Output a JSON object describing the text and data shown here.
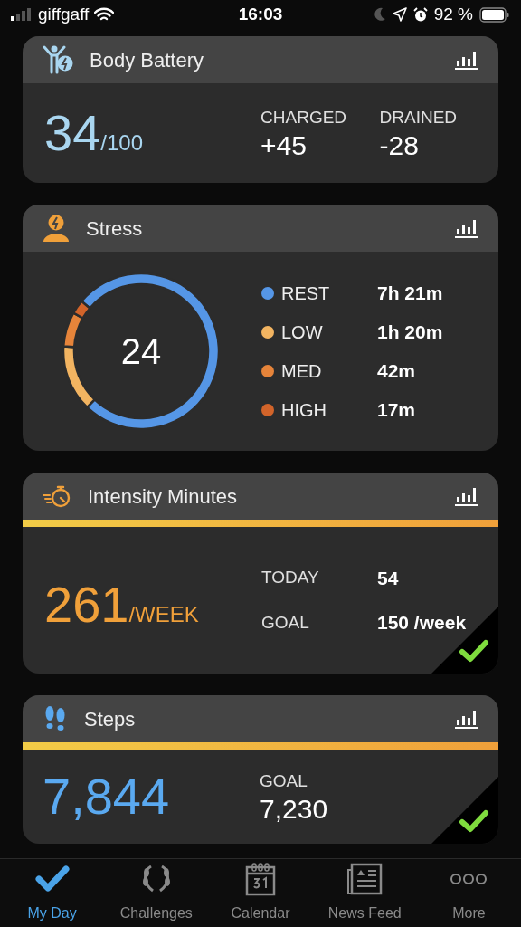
{
  "status_bar": {
    "carrier": "giffgaff",
    "time": "16:03",
    "battery": "92 %"
  },
  "body_battery": {
    "title": "Body Battery",
    "value": "34",
    "max": "/100",
    "stats": [
      {
        "label": "CHARGED",
        "value": "+45"
      },
      {
        "label": "DRAINED",
        "value": "-28"
      }
    ]
  },
  "stress": {
    "title": "Stress",
    "value": "24",
    "chart_data": {
      "type": "donut",
      "values": [
        76.1,
        13.8,
        7.2,
        2.9
      ]
    },
    "legend": [
      {
        "label": "REST",
        "duration": "7h 21m",
        "color": "#5596e6"
      },
      {
        "label": "LOW",
        "duration": "1h 20m",
        "color": "#f2b461"
      },
      {
        "label": "MED",
        "duration": "42m",
        "color": "#e6843a"
      },
      {
        "label": "HIGH",
        "duration": "17m",
        "color": "#d2642a"
      }
    ]
  },
  "intensity": {
    "title": "Intensity Minutes",
    "value": "261",
    "unit": "/WEEK",
    "goal_met": true,
    "level": 1,
    "rows": [
      {
        "label": "TODAY",
        "value": "54"
      },
      {
        "label": "GOAL",
        "value": "150 /week"
      }
    ]
  },
  "steps": {
    "title": "Steps",
    "value": "7,844",
    "goal_label": "GOAL",
    "goal": "7,230",
    "goal_met": true,
    "level": 1
  },
  "tab_bar": [
    {
      "label": "My Day",
      "selected": true
    },
    {
      "label": "Challenges",
      "selected": false
    },
    {
      "label": "Calendar",
      "selected": false
    },
    {
      "label": "News Feed",
      "selected": false
    },
    {
      "label": "More",
      "selected": false
    }
  ]
}
